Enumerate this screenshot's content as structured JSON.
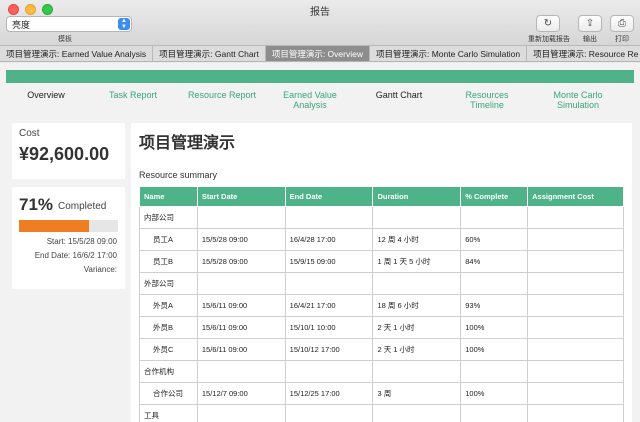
{
  "window": {
    "title": "报告"
  },
  "toolbar": {
    "template_select_value": "亮度",
    "template_label": "模板",
    "reload_label": "重新加载报告",
    "export_label": "输出",
    "print_label": "打印",
    "reload_icon": "↻",
    "export_icon": "⇪",
    "print_icon": "⎙"
  },
  "tabs": [
    {
      "label": "项目管理演示: Earned Value Analysis",
      "active": false
    },
    {
      "label": "项目管理演示: Gantt Chart",
      "active": false
    },
    {
      "label": "项目管理演示: Overview",
      "active": true
    },
    {
      "label": "项目管理演示: Monte Carlo Simulation",
      "active": false
    },
    {
      "label": "项目管理演示: Resource Re",
      "active": false
    }
  ],
  "report_nav": {
    "overview": "Overview",
    "task_report": "Task Report",
    "resource_report": "Resource Report",
    "earned_value_1": "Earned Value",
    "earned_value_2": "Analysis",
    "gantt_chart": "Gantt Chart",
    "resources_timeline_1": "Resources",
    "resources_timeline_2": "Timeline",
    "monte_carlo_1": "Monte Carlo",
    "monte_carlo_2": "Simulation"
  },
  "cost": {
    "title": "Cost",
    "value": "¥92,600.00"
  },
  "progress": {
    "percent_text": "71%",
    "completed_label": "Completed",
    "percent_value": 71,
    "fill_color": "#ef7d22",
    "start": "Start: 15/5/28 09:00",
    "end": "End Date: 16/6/2 17:00",
    "variance": "Variance:"
  },
  "main": {
    "title": "项目管理演示",
    "section": "Resource summary"
  },
  "table": {
    "headers": [
      "Name",
      "Start Date",
      "End Date",
      "Duration",
      "% Complete",
      "Assignment Cost"
    ],
    "rows": [
      {
        "group": "内部公司"
      },
      {
        "name": "员工A",
        "start": "15/5/28 09:00",
        "end": "16/4/28 17:00",
        "duration": "12 周 4 小时",
        "complete": "60%",
        "cost": ""
      },
      {
        "name": "员工B",
        "start": "15/5/28 09:00",
        "end": "15/9/15 09:00",
        "duration": "1 周 1 天 5 小时",
        "complete": "84%",
        "cost": ""
      },
      {
        "group": "外部公司"
      },
      {
        "name": "外员A",
        "start": "15/6/11 09:00",
        "end": "16/4/21 17:00",
        "duration": "18 周 6 小时",
        "complete": "93%",
        "cost": ""
      },
      {
        "name": "外员B",
        "start": "15/6/11 09:00",
        "end": "15/10/1 10:00",
        "duration": "2 天 1 小时",
        "complete": "100%",
        "cost": ""
      },
      {
        "name": "外员C",
        "start": "15/6/11 09:00",
        "end": "15/10/12 17:00",
        "duration": "2 天 1 小时",
        "complete": "100%",
        "cost": ""
      },
      {
        "group": "合作机构"
      },
      {
        "name": "合作公司",
        "start": "15/12/7 09:00",
        "end": "15/12/25 17:00",
        "duration": "3 周",
        "complete": "100%",
        "cost": ""
      },
      {
        "group": "工具"
      }
    ]
  },
  "colors": {
    "accent": "#4fb389",
    "progress": "#ef7d22"
  }
}
